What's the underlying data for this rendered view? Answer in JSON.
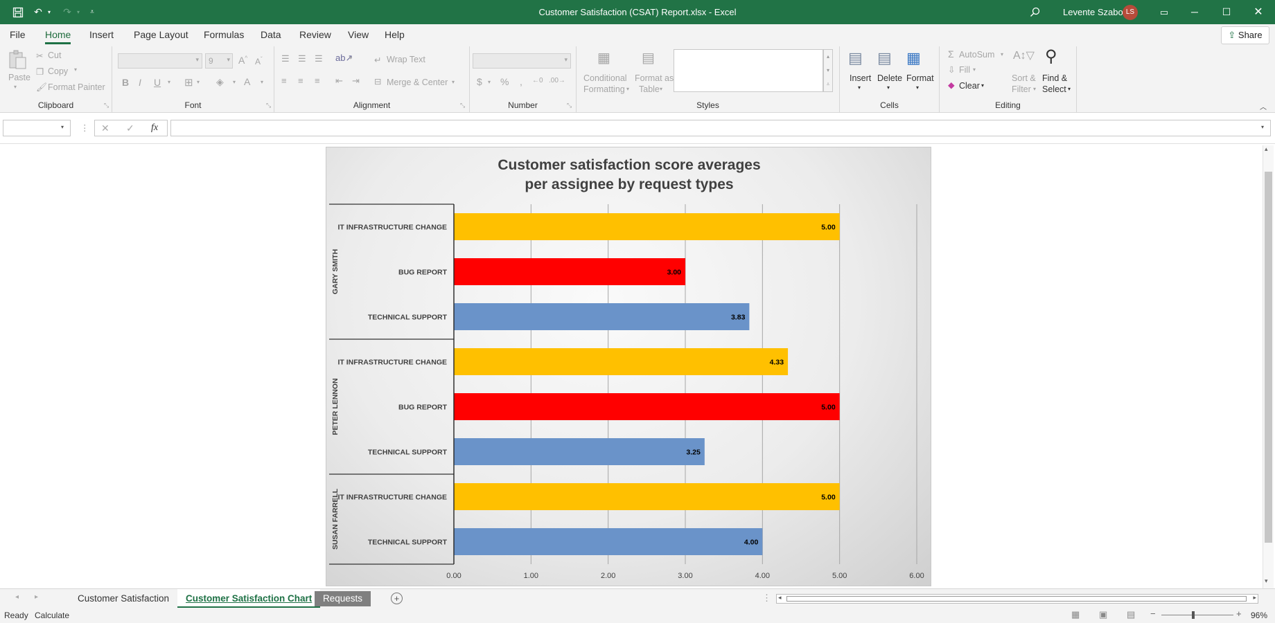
{
  "window": {
    "title": "Customer Satisfaction (CSAT) Report.xlsx  -  Excel",
    "user": "Levente Szabo",
    "initials": "LS"
  },
  "menu": {
    "items": [
      "File",
      "Home",
      "Insert",
      "Page Layout",
      "Formulas",
      "Data",
      "Review",
      "View",
      "Help"
    ],
    "active": "Home",
    "share": "Share"
  },
  "ribbon": {
    "clipboard": {
      "paste": "Paste",
      "cut": "Cut",
      "copy": "Copy",
      "format_painter": "Format Painter",
      "label": "Clipboard"
    },
    "font": {
      "size": "9",
      "label": "Font"
    },
    "alignment": {
      "wrap": "Wrap Text",
      "merge": "Merge & Center",
      "label": "Alignment"
    },
    "number": {
      "label": "Number"
    },
    "styles": {
      "conditional": "Conditional",
      "formatting": "Formatting",
      "format_as": "Format as",
      "table": "Table",
      "label": "Styles"
    },
    "cells": {
      "insert": "Insert",
      "delete": "Delete",
      "format": "Format",
      "label": "Cells"
    },
    "editing": {
      "autosum": "AutoSum",
      "fill": "Fill",
      "clear": "Clear",
      "sort": "Sort &",
      "filter": "Filter",
      "find": "Find &",
      "select": "Select",
      "label": "Editing"
    }
  },
  "formula_bar": {
    "name_box": "",
    "formula": "",
    "fx": "fx"
  },
  "chart_data": {
    "type": "bar",
    "orientation": "horizontal",
    "title": "Customer satisfaction score averages per assignee by request types",
    "title_lines": [
      "Customer satisfaction score averages",
      "per assignee by request types"
    ],
    "xlim": [
      0,
      6
    ],
    "xticks": [
      "0.00",
      "1.00",
      "2.00",
      "3.00",
      "4.00",
      "5.00",
      "6.00"
    ],
    "groups": [
      {
        "name": "GARY SMITH",
        "items": [
          {
            "category": "IT INFRASTRUCTURE CHANGE",
            "value": 5.0,
            "label": "5.00",
            "color": "#ffc000"
          },
          {
            "category": "BUG REPORT",
            "value": 3.0,
            "label": "3.00",
            "color": "#ff0000"
          },
          {
            "category": "TECHNICAL SUPPORT",
            "value": 3.83,
            "label": "3.83",
            "color": "#6a93c9"
          }
        ]
      },
      {
        "name": "PETER LENNON",
        "items": [
          {
            "category": "IT INFRASTRUCTURE CHANGE",
            "value": 4.33,
            "label": "4.33",
            "color": "#ffc000"
          },
          {
            "category": "BUG REPORT",
            "value": 5.0,
            "label": "5.00",
            "color": "#ff0000"
          },
          {
            "category": "TECHNICAL SUPPORT",
            "value": 3.25,
            "label": "3.25",
            "color": "#6a93c9"
          }
        ]
      },
      {
        "name": "SUSAN FARRELL",
        "items": [
          {
            "category": "IT INFRASTRUCTURE CHANGE",
            "value": 5.0,
            "label": "5.00",
            "color": "#ffc000"
          },
          {
            "category": "TECHNICAL SUPPORT",
            "value": 4.0,
            "label": "4.00",
            "color": "#6a93c9"
          }
        ]
      }
    ]
  },
  "sheet_tabs": {
    "tabs": [
      "Customer Satisfaction",
      "Customer Satisfaction Chart",
      "Requests"
    ],
    "active": "Customer Satisfaction Chart"
  },
  "status": {
    "ready": "Ready",
    "calculate": "Calculate",
    "zoom": "96%"
  }
}
